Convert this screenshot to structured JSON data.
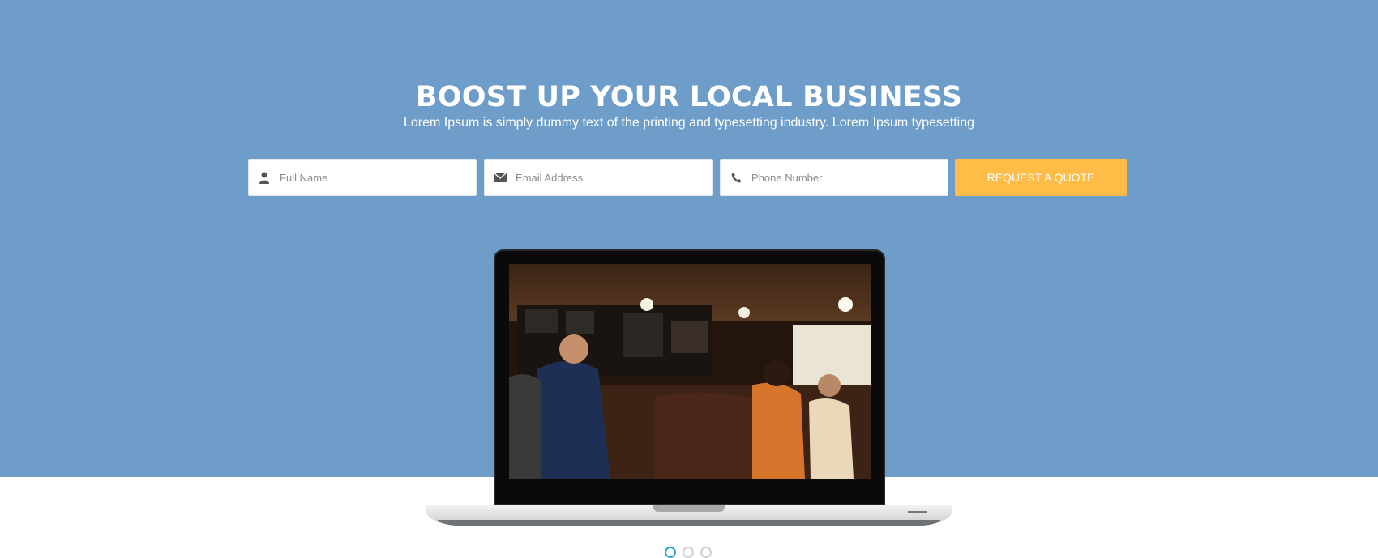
{
  "hero": {
    "title": "BOOST UP YOUR LOCAL BUSINESS",
    "subtitle": "Lorem Ipsum is simply dummy text of the printing and typesetting industry. Lorem Ipsum typesetting"
  },
  "form": {
    "full_name": {
      "placeholder": "Full Name",
      "value": "",
      "icon": "user-icon"
    },
    "email": {
      "placeholder": "Email Address",
      "value": "",
      "icon": "envelope-icon"
    },
    "phone": {
      "placeholder": "Phone Number",
      "value": "",
      "icon": "phone-icon"
    },
    "submit_label": "REQUEST A QUOTE"
  },
  "carousel": {
    "slide_count": 3,
    "active_index": 0
  },
  "colors": {
    "hero_bg": "#6f9dca",
    "accent_button": "#ffbd47",
    "active_dot": "#2aa6d8"
  }
}
